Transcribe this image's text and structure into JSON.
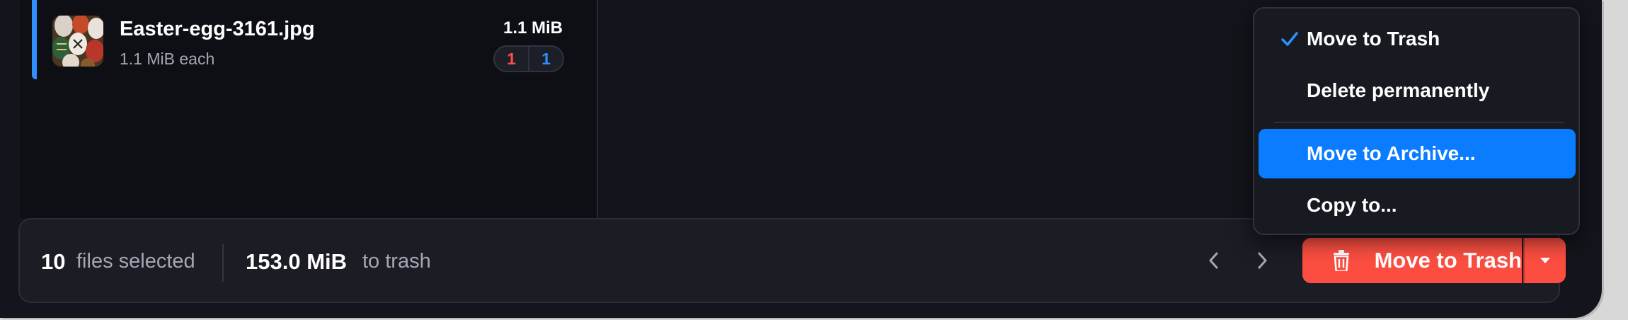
{
  "file_list": {
    "row": {
      "name": "Easter-egg-3161.jpg",
      "sub": "1.1 MiB each",
      "size": "1.1 MiB",
      "count_red": "1",
      "count_blue": "1"
    }
  },
  "bottom_bar": {
    "selected_count": "10",
    "selected_label": "files selected",
    "trash_amount": "153.0 MiB",
    "trash_label": "to trash",
    "primary_action": "Move to Trash"
  },
  "menu": {
    "items": [
      {
        "label": "Move to Trash",
        "checked": true
      },
      {
        "label": "Delete permanently",
        "checked": false
      },
      {
        "label": "Move to Archive...",
        "checked": false
      },
      {
        "label": "Copy to...",
        "checked": false
      }
    ]
  },
  "colors": {
    "accent": "#2f8fff",
    "danger": "#fb4e41",
    "menu_highlight": "#0a7cff"
  },
  "icons": {
    "check": "check-icon",
    "prev": "chevron-left-icon",
    "next": "chevron-right-icon",
    "trash": "trash-icon",
    "dropdown": "caret-down-icon"
  }
}
